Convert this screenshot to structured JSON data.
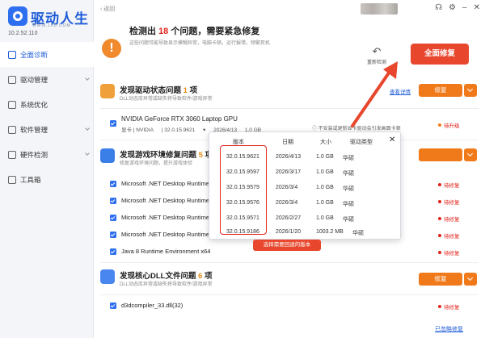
{
  "app": {
    "name": "驱动人生",
    "url": "WWW.160.COM",
    "version": "10.2.52.110"
  },
  "sidebar": {
    "items": [
      {
        "label": "全面诊断",
        "icon": "monitor-icon",
        "active": true
      },
      {
        "label": "驱动管理",
        "icon": "gear-icon"
      },
      {
        "label": "系统优化",
        "icon": "rocket-icon"
      },
      {
        "label": "软件管理",
        "icon": "apps-icon"
      },
      {
        "label": "硬件检测",
        "icon": "chip-icon"
      },
      {
        "label": "工具箱",
        "icon": "toolbox-icon"
      }
    ]
  },
  "topbar": {
    "back_label": "返回",
    "icons": [
      "headset-icon",
      "gear-icon",
      "minimize-icon",
      "close-icon"
    ]
  },
  "summary": {
    "title_prefix": "检测出",
    "count": "18",
    "title_suffix": "个问题，需要紧急修复",
    "subtitle": "这些问题可能导致显示摸糊异常，电脑卡顿，运行报错，频繁死机",
    "rescan_label": "重新检测",
    "fix_all_label": "全面修复",
    "accent": "#e8462d"
  },
  "sections": {
    "driver": {
      "title": "发现驱动状态问题",
      "count": "1",
      "unit": "项",
      "subtitle": "DLL动态库异常或缺失将导致软件/游戏异常",
      "link": "查看详情",
      "fix_label": "修复"
    },
    "game": {
      "title": "发现游戏环境修复问题",
      "count": "5",
      "unit": "项",
      "subtitle": "修复游戏环境问题，提升游戏体验"
    },
    "dll": {
      "title": "发现核心DLL文件问题",
      "count": "6",
      "unit": "项",
      "subtitle": "DLL动态库异常或缺失将导致软件/游戏异常",
      "fix_label": "修复"
    }
  },
  "gpu": {
    "name": "NVIDIA GeForce RTX 3060 Laptop GPU",
    "category": "显卡 | NVIDIA",
    "version": "| 32.0.15.9621",
    "date": "2026/4/13",
    "size": "1.0 GB",
    "note": "不安装或更新显卡驱动会引发画面卡顿",
    "status": "待升级"
  },
  "game_rows": [
    {
      "name": "Microsoft .NET Desktop Runtime",
      "status": "待修复"
    },
    {
      "name": "Microsoft .NET Desktop Runtime",
      "status": "待修复"
    },
    {
      "name": "Microsoft .NET Desktop Runtime",
      "status": "待修复"
    },
    {
      "name": "Microsoft .NET Desktop Runtime 10.0 x86",
      "status": "待修复"
    },
    {
      "name": "Java 8 Runtime Environment x64",
      "status": "待修复"
    }
  ],
  "dll_rows": [
    {
      "name": "d3dcompiler_33.dll(32)",
      "status": "待修复"
    }
  ],
  "popup": {
    "headers": [
      "版本",
      "日期",
      "大小",
      "驱动类型"
    ],
    "rows": [
      {
        "version": "32.0.15.9621",
        "date": "2026/4/13",
        "size": "1.0 GB",
        "type": "华硕"
      },
      {
        "version": "32.0.15.9597",
        "date": "2026/3/17",
        "size": "1.0 GB",
        "type": "华硕"
      },
      {
        "version": "32.0.15.9579",
        "date": "2026/3/4",
        "size": "1.0 GB",
        "type": "华硕"
      },
      {
        "version": "32.0.15.9576",
        "date": "2026/3/4",
        "size": "1.0 GB",
        "type": "华硕"
      },
      {
        "version": "32.0.15.9571",
        "date": "2026/2/27",
        "size": "1.0 GB",
        "type": "华硕"
      },
      {
        "version": "32.0.15.9186",
        "date": "2026/1/20",
        "size": "1003.2 MB",
        "type": "华硕"
      }
    ],
    "tip": "选择需要回退的版本"
  },
  "bottom_link": "已忽略修复"
}
